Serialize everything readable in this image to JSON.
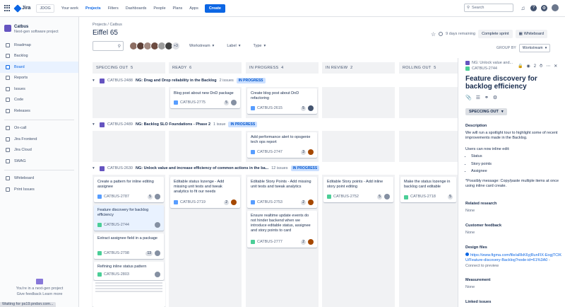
{
  "topnav": {
    "logo": "Jira",
    "items": [
      "JDOG",
      "Your work",
      "Projects",
      "Filters",
      "Dashboards",
      "People",
      "Plans",
      "Apps"
    ],
    "active": "Projects",
    "create": "Create",
    "search_placeholder": "Search"
  },
  "sidebar": {
    "project_name": "Catbus",
    "project_type": "Next-gen software project",
    "items": [
      "Roadmap",
      "Backlog",
      "Board",
      "Reports",
      "Issues",
      "Code",
      "Releases",
      "On-call",
      "Jira Frontend",
      "Jira Cloud",
      "SWAG",
      "Whiteboard",
      "Print Issues"
    ],
    "active": "Board",
    "footer_line1": "You're in a next-gen project",
    "footer_line2": "Give feedback    Learn more"
  },
  "header": {
    "breadcrumb": "Projects  /  Catbus",
    "title": "Eiffel 65",
    "days_remaining": "9 days remaining",
    "complete_sprint": "Complete sprint",
    "whiteboard": "Whiteboard"
  },
  "filters": {
    "avatar_more": "+3",
    "workstream": "Workstream",
    "label": "Label",
    "type": "Type",
    "group_by_label": "GROUP BY",
    "group_by_value": "Workstream"
  },
  "columns": [
    {
      "name": "SPECCING OUT",
      "count": "5"
    },
    {
      "name": "READY",
      "count": "6"
    },
    {
      "name": "IN PROGRESS",
      "count": "4"
    },
    {
      "name": "IN REVIEW",
      "count": "2"
    },
    {
      "name": "ROLLING OUT",
      "count": "5"
    }
  ],
  "swimlanes": [
    {
      "key": "CATBUS-2488",
      "summary": "NG: Drag and Drop reliability in the Backlog",
      "count": "2 issues",
      "status": "IN PROGRESS"
    },
    {
      "key": "CATBUS-2489",
      "summary": "NG: Backlog SLO Foundations - Phase 2",
      "count": "1 issue",
      "status": "IN PROGRESS"
    },
    {
      "key": "CATBUS-2630",
      "summary": "NG: Unlock value and increase efficiency of common actions in the ba...",
      "count": "12 issues",
      "status": "IN PROGRESS"
    }
  ],
  "cards": {
    "c1": {
      "title": "Blog post about new DnD package",
      "key": "CATBUS-2775",
      "est": "5"
    },
    "c2": {
      "title": "Create blog post about DnD refactoring",
      "key": "CATBUS-2615",
      "est": "5"
    },
    "c3": {
      "title": "Add performance alert to opsgenie tech ops report",
      "key": "CATBUS-2747",
      "est": "3"
    },
    "c4": {
      "title": "Create a pattern for inline editing assignee",
      "key": "CATBUS-2787",
      "est": "5"
    },
    "c5": {
      "title": "Feature discovery for backlog efficiency",
      "key": "CATBUS-2744",
      "est": ""
    },
    "c6": {
      "title": "Extract assignee field in a package",
      "key": "CATBUS-2798",
      "est": "13"
    },
    "c7": {
      "title": "Refining inline status pattern",
      "key": "CATBUS-2803",
      "est": ""
    },
    "c8": {
      "title": "Editable status lozenge - Add missing unit tests and tweak analytics to fit our needs",
      "key": "CATBUS-2719",
      "est": "2"
    },
    "c9": {
      "title": "Editable Story Points - Add missing unit tests and tweak analytics",
      "key": "CATBUS-2753",
      "est": "2"
    },
    "c10": {
      "title": "Ensure realtime update events do not hinder backend when we introduce editable status, assignee and story points to card",
      "key": "CATBUS-2777",
      "est": "2"
    },
    "c11": {
      "title": "Editable Story points - Add inline story point editing",
      "key": "CATBUS-2752",
      "est": "5"
    },
    "c12": {
      "title": "Make the status lozenge in backlog card editable",
      "key": "CATBUS-2718",
      "est": "5"
    }
  },
  "panel": {
    "parent": "NG: Unlock value and...",
    "key": "CATBUS-2744",
    "watchers": "2",
    "title": "Feature discovery for backlog efficiency",
    "status": "SPECCING OUT",
    "description_label": "Description",
    "description_p1": "We will run a spotlight tour to highlight some of recent improvements made in the Backlog.",
    "description_p2": "Users can now inline edit:",
    "bullets": [
      "Status",
      "Story points",
      "Assignee"
    ],
    "description_p3": "*Possibly message: Copy/paste multiple items at once using inline card create.",
    "related_label": "Related research",
    "related_value": "None",
    "customer_label": "Customer feedback",
    "customer_value": "None",
    "design_label": "Design files",
    "design_link": "https://www.figma.com/file/aRkK6yjRunFlX-EogjTClKU/Feature-discovery-Backlog?node-id=61%3A0",
    "design_suffix": " - Connect to preview",
    "measurement_label": "Measurement",
    "measurement_value": "None",
    "linked_label": "Linked issues"
  },
  "statusbar": "Waiting for ps19.pndsn.com..."
}
